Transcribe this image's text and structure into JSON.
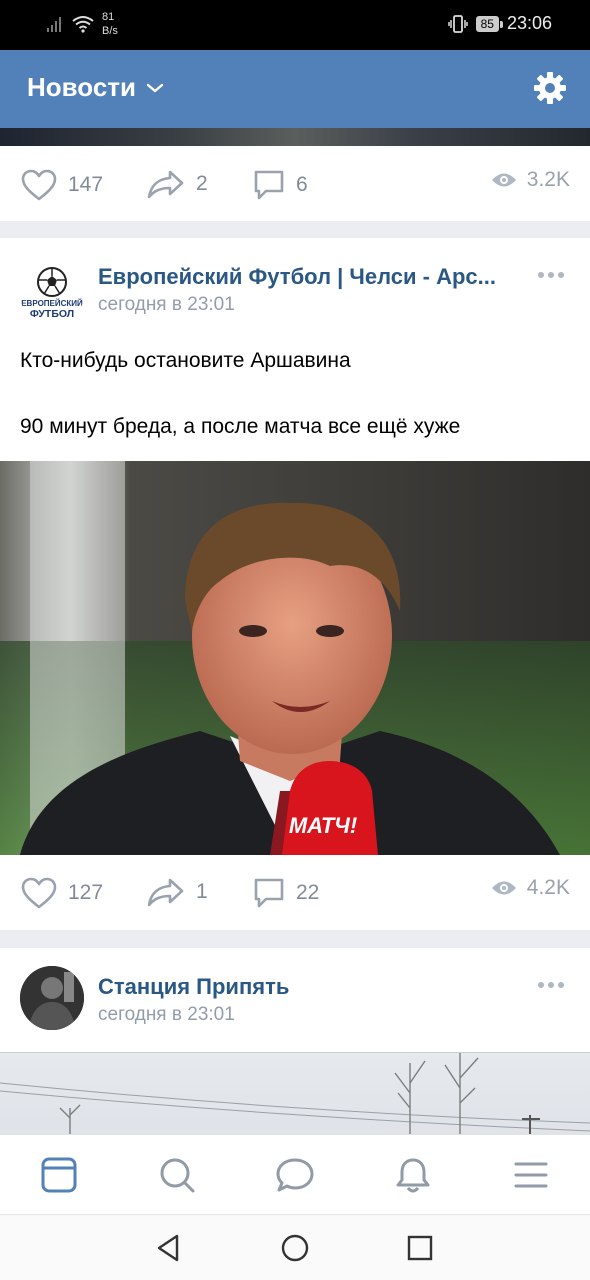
{
  "status_bar": {
    "speed_value": "81",
    "speed_unit": "B/s",
    "battery": "85",
    "time": "23:06"
  },
  "header": {
    "title": "Новости",
    "icons": [
      "chevron-down-icon",
      "gear-icon"
    ]
  },
  "posts": [
    {
      "likes": "147",
      "shares": "2",
      "comments": "6",
      "views": "3.2K"
    },
    {
      "author": "Европейский Футбол | Челси - Арс...",
      "time": "сегодня в 23:01",
      "avatar_text_line1": "ЕВРОПЕЙСКИЙ",
      "avatar_text_line2": "ФУТБОЛ",
      "text_line1": "Кто-нибудь остановите Аршавина",
      "text_line2": "90 минут бреда, а после матча все ещё хуже",
      "microphone_text": "МАТЧ!",
      "likes": "127",
      "shares": "1",
      "comments": "22",
      "views": "4.2K"
    },
    {
      "author": "Станция Припять",
      "time": "сегодня в 23:01"
    }
  ],
  "bottom_nav": [
    "news-icon",
    "search-icon",
    "messages-icon",
    "notifications-icon",
    "menu-icon"
  ],
  "system_nav": [
    "back-icon",
    "home-icon",
    "recents-icon"
  ],
  "colors": {
    "header": "#5181b8",
    "link": "#2a5885",
    "meta": "#939cab",
    "action": "#828a99",
    "background": "#ebedf0"
  }
}
